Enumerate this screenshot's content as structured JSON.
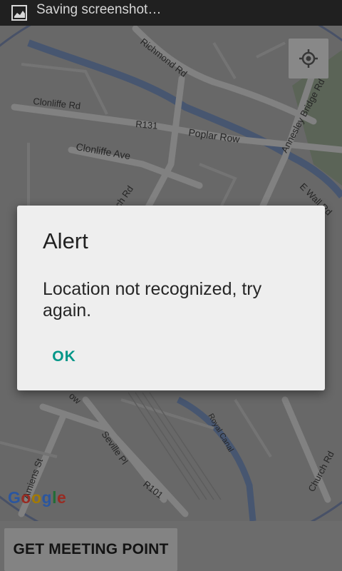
{
  "status_bar": {
    "text": "Saving screenshot…",
    "icon": "screenshot-icon"
  },
  "map": {
    "labels": {
      "richmond_rd": "Richmond Rd",
      "clonliffe_rd": "Clonliffe Rd",
      "r131": "R131",
      "poplar_row": "Poplar Row",
      "annesley_bridge_rd": "Annesley Bridge Rd",
      "clonliffe_ave": "Clonliffe Ave",
      "e_wall_rd": "E Wall Rd",
      "ch_rd_fragment": "ch Rd",
      "royal_canal": "Royal Canal",
      "seville_pl": "Seville Pl",
      "r101": "R101",
      "church_rd": "Church Rd",
      "amiens_st": "Amiens St",
      "ow_fragment": "ow"
    },
    "google_logo": [
      "G",
      "o",
      "o",
      "g",
      "l",
      "e"
    ],
    "google_colors": [
      "#4285F4",
      "#EA4335",
      "#FBBC05",
      "#4285F4",
      "#34A853",
      "#EA4335"
    ]
  },
  "dialog": {
    "title": "Alert",
    "message": "Location not recognized, try again.",
    "ok_label": "OK"
  },
  "bottom": {
    "meeting_button": "GET MEETING POINT"
  }
}
